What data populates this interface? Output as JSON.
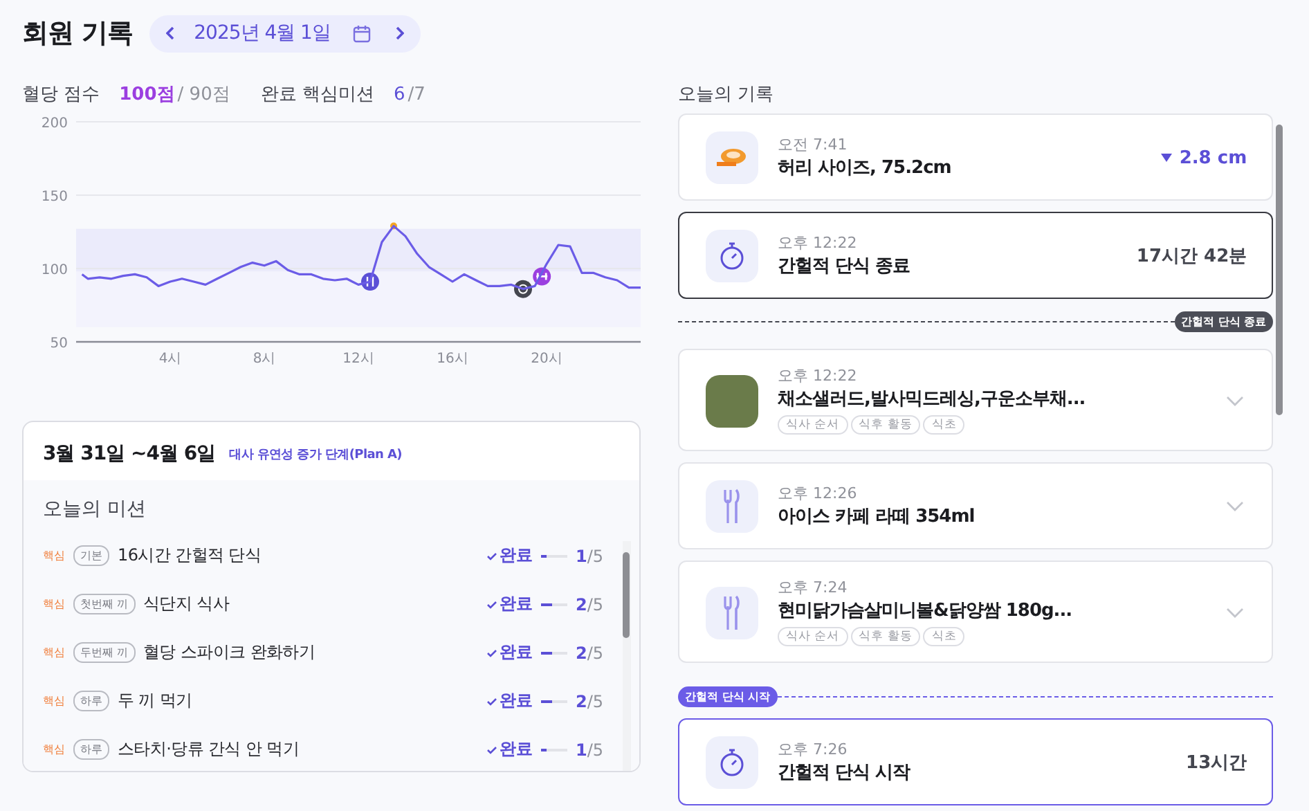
{
  "header": {
    "title": "회원 기록",
    "date": "2025년 4월 1일"
  },
  "stats": [
    {
      "label": "혈당 점수",
      "value": "100점",
      "sub": "/ 90점",
      "kind": "score"
    },
    {
      "label": "완료 핵심미션",
      "value": "6",
      "sub": "/7",
      "kind": "count"
    }
  ],
  "chart_data": {
    "type": "line",
    "x": [
      0.25,
      0.5,
      1,
      1.5,
      2,
      2.5,
      3,
      3.5,
      4,
      4.5,
      5,
      5.5,
      6,
      6.5,
      7,
      7.5,
      8,
      8.5,
      9,
      9.5,
      10,
      10.5,
      11,
      11.5,
      12,
      12.5,
      13,
      13.5,
      14,
      14.5,
      15,
      15.5,
      16,
      16.5,
      17,
      17.5,
      18,
      18.5,
      19,
      19.5,
      20,
      20.5,
      21,
      21.5,
      22,
      22.5,
      23,
      23.5,
      24
    ],
    "series": [
      {
        "color": "#6b5ce7",
        "values": [
          96,
          93,
          94,
          93,
          95,
          96,
          94,
          88,
          91,
          93,
          91,
          89,
          93,
          97,
          101,
          104,
          102,
          105,
          99,
          96,
          96,
          93,
          92,
          93,
          89,
          91,
          118,
          129,
          122,
          110,
          101,
          96,
          91,
          96,
          92,
          88,
          88,
          89,
          86,
          88,
          103,
          116,
          115,
          97,
          97,
          94,
          92,
          87,
          87
        ]
      }
    ],
    "xlim": [
      0,
      24
    ],
    "ylim": [
      50,
      200
    ],
    "yticks": [
      50,
      100,
      150,
      200
    ],
    "xticks": [
      {
        "value": 4,
        "label": "4시"
      },
      {
        "value": 8,
        "label": "8시"
      },
      {
        "value": 12,
        "label": "12시"
      },
      {
        "value": 16,
        "label": "16시"
      },
      {
        "value": 20,
        "label": "20시"
      }
    ],
    "bands": [
      {
        "axis": "y",
        "from": 60,
        "to": 127,
        "color": "#f3f3fd"
      },
      {
        "axis": "y",
        "from": 98,
        "to": 127,
        "color": "#ebebfb"
      }
    ]
  },
  "chart_events": [
    {
      "kind": "meal"
    },
    {
      "kind": "fasting"
    },
    {
      "kind": "exercise"
    },
    {
      "kind": "peak"
    }
  ],
  "week": {
    "range": "3월 31일 ~4월 6일",
    "plan": "대사 유연성 증가 단계(Plan A)"
  },
  "missions_title": "오늘의 미션",
  "missions": [
    {
      "tag": "핵심",
      "badge": "기본",
      "name": "16시간 간헐적 단식",
      "status": "완료",
      "level": 0.2,
      "done": "1",
      "total": "/5"
    },
    {
      "tag": "핵심",
      "badge": "첫번째 끼",
      "name": "식단지 식사",
      "status": "완료",
      "level": 0.4,
      "done": "2",
      "total": "/5"
    },
    {
      "tag": "핵심",
      "badge": "두번째 끼",
      "name": "혈당 스파이크 완화하기",
      "status": "완료",
      "level": 0.4,
      "done": "2",
      "total": "/5"
    },
    {
      "tag": "핵심",
      "badge": "하루",
      "name": "두 끼 먹기",
      "status": "완료",
      "level": 0.4,
      "done": "2",
      "total": "/5"
    },
    {
      "tag": "핵심",
      "badge": "하루",
      "name": "스타치·당류 간식 안 먹기",
      "status": "완료",
      "level": 0.2,
      "done": "1",
      "total": "/5"
    }
  ],
  "records_title": "오늘의 기록",
  "records": [
    {
      "kind": "waist",
      "time": "오전 7:41",
      "title": "허리 사이즈, 75.2cm",
      "value": "2.8 cm"
    },
    {
      "kind": "fast_end",
      "time": "오후 12:22",
      "title": "간헐적 단식 종료",
      "value": "17시간 42분"
    },
    {
      "kind": "end_marker",
      "label": "간헐적 단식 종료"
    },
    {
      "kind": "meal_photo",
      "time": "오후 12:22",
      "title": "채소샐러드,발사믹드레싱,구운소부채...",
      "tags": [
        "식사 순서",
        "식후 활동",
        "식초"
      ],
      "expanded": false
    },
    {
      "kind": "meal",
      "time": "오후 12:26",
      "title": "아이스 카페 라떼 354ml",
      "expanded": false
    },
    {
      "kind": "meal",
      "time": "오후 7:24",
      "title": "현미닭가슴살미니볼&닭양쌈 180g...",
      "tags": [
        "식사 순서",
        "식후 활동",
        "식초"
      ],
      "expanded": false
    },
    {
      "kind": "start_marker",
      "label": "간헐적 단식 시작"
    },
    {
      "kind": "fast_start",
      "time": "오후 7:26",
      "title": "간헐적 단식 시작",
      "value": "13시간"
    }
  ]
}
